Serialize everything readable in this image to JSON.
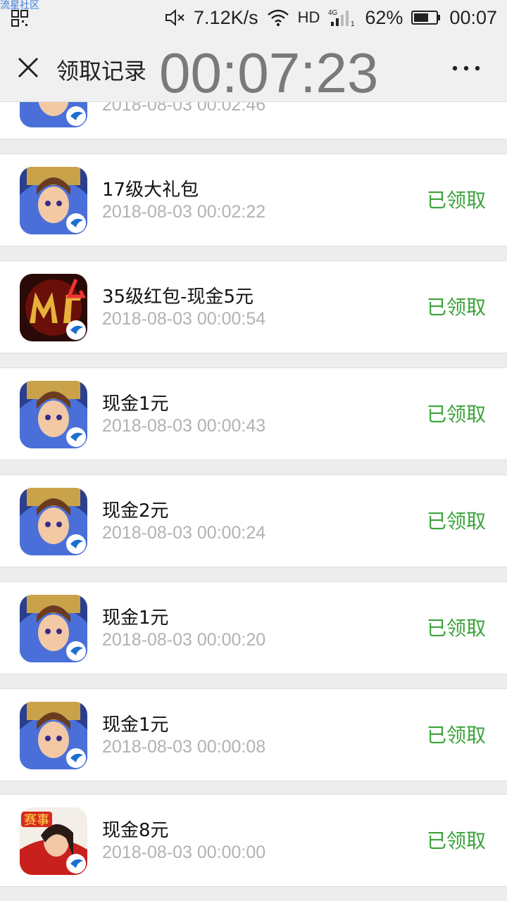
{
  "status_bar": {
    "watermark": "流星社区",
    "speed": "7.12K/s",
    "network_label": "HD",
    "network_type": "4G",
    "battery": "62%",
    "clock": "00:07"
  },
  "header": {
    "title": "领取记录",
    "timer_overlay": "00:07:23"
  },
  "records": [
    {
      "title": "",
      "time": "2018-08-03 00:02:46",
      "status": "",
      "icon": "saint-seiya-game-icon"
    },
    {
      "title": "17级大礼包",
      "time": "2018-08-03 00:02:22",
      "status": "已领取",
      "icon": "saint-seiya-game-icon"
    },
    {
      "title": "35级红包-现金5元",
      "time": "2018-08-03 00:00:54",
      "status": "已领取",
      "icon": "mt4-game-icon"
    },
    {
      "title": "现金1元",
      "time": "2018-08-03 00:00:43",
      "status": "已领取",
      "icon": "saint-seiya-game-icon"
    },
    {
      "title": "现金2元",
      "time": "2018-08-03 00:00:24",
      "status": "已领取",
      "icon": "saint-seiya-game-icon"
    },
    {
      "title": "现金1元",
      "time": "2018-08-03 00:00:20",
      "status": "已领取",
      "icon": "saint-seiya-game-icon"
    },
    {
      "title": "现金1元",
      "time": "2018-08-03 00:00:08",
      "status": "已领取",
      "icon": "saint-seiya-game-icon"
    },
    {
      "title": "现金8元",
      "time": "2018-08-03 00:00:00",
      "status": "已领取",
      "icon": "kof-saishi-game-icon"
    }
  ],
  "colors": {
    "status_green": "#3aa33a",
    "timestamp_gray": "#b2b2b2",
    "background": "#ededed"
  }
}
